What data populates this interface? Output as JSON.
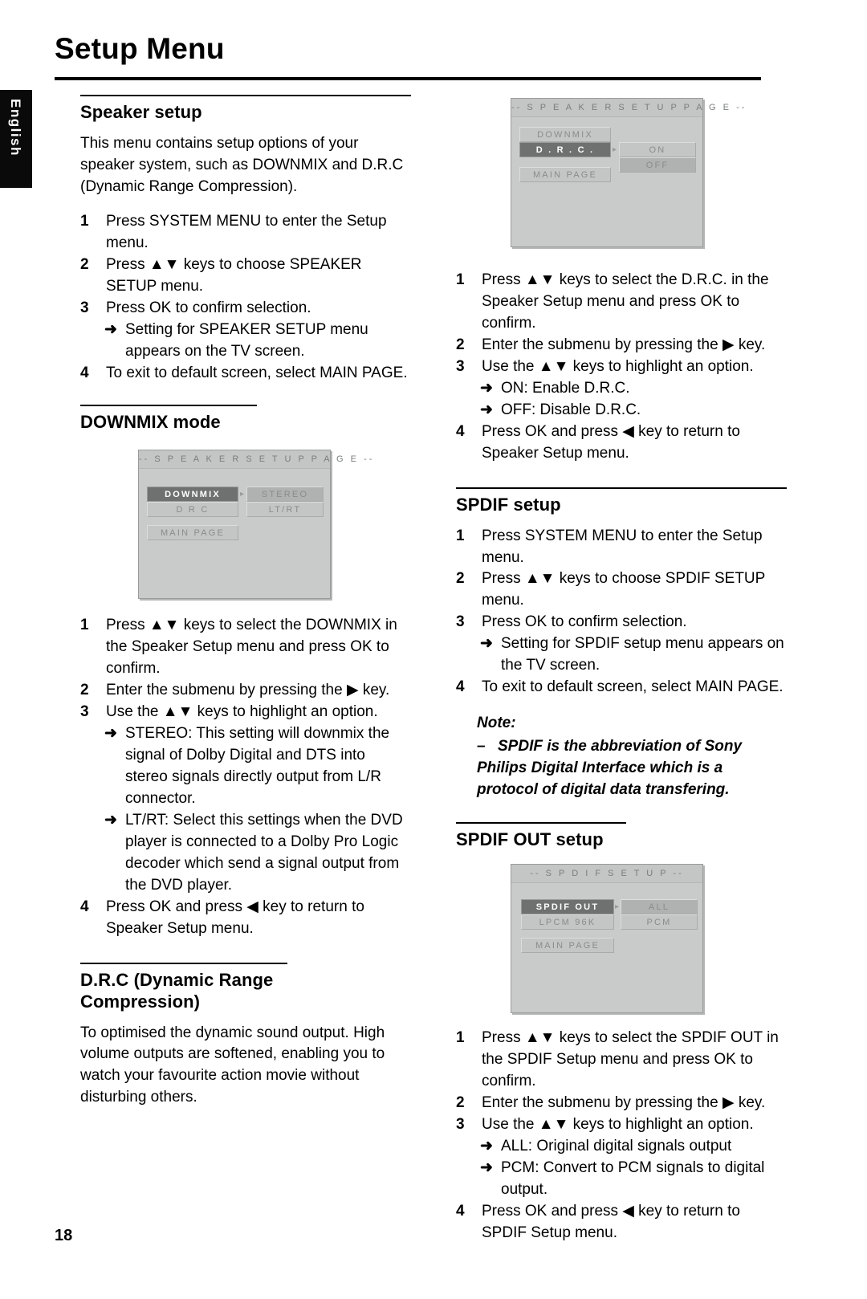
{
  "page": {
    "title": "Setup Menu",
    "number": "18",
    "language_tab": "English"
  },
  "left_column": {
    "speaker_setup": {
      "heading": "Speaker setup",
      "intro": "This menu contains setup options of your speaker system, such as DOWNMIX and D.R.C (Dynamic Range Compression).",
      "steps": [
        {
          "num": "1",
          "text": "Press SYSTEM MENU to enter the Setup menu."
        },
        {
          "num": "2",
          "text": "Press ▲▼ keys to choose SPEAKER SETUP menu."
        },
        {
          "num": "3",
          "text": "Press OK to confirm selection."
        },
        {
          "num": "4",
          "text": "To exit to default screen, select MAIN PAGE."
        }
      ],
      "arrow_after_step3": "Setting for SPEAKER SETUP menu appears on the TV screen."
    },
    "downmix": {
      "heading": "DOWNMIX mode",
      "osd": {
        "title": "--  S P E A K E R   S E T U P   P A G E  --",
        "items": [
          {
            "label": "DOWNMIX",
            "state": "selected"
          },
          {
            "label": "D  R  C",
            "state": "normal"
          },
          {
            "label": "MAIN PAGE",
            "state": "normal"
          }
        ],
        "sub_items": [
          {
            "label": "STEREO",
            "state": "sub-selected"
          },
          {
            "label": "LT/RT",
            "state": "normal"
          }
        ]
      },
      "steps": [
        {
          "num": "1",
          "text": "Press ▲▼ keys to select the DOWNMIX in the Speaker Setup menu and press OK to confirm."
        },
        {
          "num": "2",
          "text": "Enter the submenu by pressing the ▶ key."
        },
        {
          "num": "3",
          "text": "Use the ▲▼ keys to highlight an option."
        },
        {
          "num": "4",
          "text": "Press OK and press ◀ key to return to Speaker Setup menu."
        }
      ],
      "arrows_after_step3": [
        "STEREO: This setting will downmix the signal of Dolby Digital and DTS into stereo signals directly output from L/R connector.",
        "LT/RT: Select this settings when the DVD player is connected to a Dolby Pro Logic decoder which send a signal output from the DVD player."
      ]
    },
    "drc": {
      "heading_line1": "D.R.C (Dynamic Range",
      "heading_line2": "Compression)",
      "text": "To optimised the dynamic sound output. High volume outputs are softened, enabling you to watch your favourite action movie without disturbing others."
    }
  },
  "right_column": {
    "drc_osd": {
      "title": "--  S P E A K E R   S E T U P   P A G E  --",
      "items": [
        {
          "label": "DOWNMIX",
          "state": "normal"
        },
        {
          "label": "D . R . C .",
          "state": "selected"
        },
        {
          "label": "MAIN PAGE",
          "state": "normal"
        }
      ],
      "sub_items": [
        {
          "label": "ON",
          "state": "normal"
        },
        {
          "label": "OFF",
          "state": "sub-selected"
        }
      ]
    },
    "drc_steps": [
      {
        "num": "1",
        "text": "Press ▲▼ keys to select the D.R.C. in the Speaker Setup menu and press OK to confirm."
      },
      {
        "num": "2",
        "text": "Enter the submenu by pressing the ▶ key."
      },
      {
        "num": "3",
        "text": "Use the ▲▼ keys to highlight an option."
      },
      {
        "num": "4",
        "text": "Press OK and press ◀ key to return to Speaker Setup menu."
      }
    ],
    "drc_arrows": [
      "ON: Enable D.R.C.",
      "OFF: Disable D.R.C."
    ],
    "spdif_setup": {
      "heading": "SPDIF setup",
      "steps": [
        {
          "num": "1",
          "text": "Press SYSTEM MENU to enter the Setup menu."
        },
        {
          "num": "2",
          "text": "Press ▲▼ keys to choose SPDIF SETUP menu."
        },
        {
          "num": "3",
          "text": "Press OK to confirm selection."
        },
        {
          "num": "4",
          "text": "To exit to default screen, select MAIN PAGE."
        }
      ],
      "arrow_after_step3": "Setting for SPDIF setup menu appears on the TV screen.",
      "note_title": "Note:",
      "note_dash": "–",
      "note_text": "SPDIF is the abbreviation of Sony Philips Digital Interface which is a protocol of digital data transfering."
    },
    "spdif_out": {
      "heading": "SPDIF OUT setup",
      "osd": {
        "title": "--  S P D I F   S E T U P  --",
        "items": [
          {
            "label": "SPDIF OUT",
            "state": "selected"
          },
          {
            "label": "LPCM 96K",
            "state": "normal"
          },
          {
            "label": "MAIN PAGE",
            "state": "normal"
          }
        ],
        "sub_items": [
          {
            "label": "ALL",
            "state": "sub-selected"
          },
          {
            "label": "PCM",
            "state": "normal"
          }
        ]
      },
      "steps": [
        {
          "num": "1",
          "text": "Press ▲▼ keys to select the SPDIF OUT in the SPDIF Setup menu and press OK to confirm."
        },
        {
          "num": "2",
          "text": "Enter the submenu by pressing the ▶ key."
        },
        {
          "num": "3",
          "text": "Use the ▲▼ keys to highlight an option."
        },
        {
          "num": "4",
          "text": "Press OK and press ◀ key to return to SPDIF Setup menu."
        }
      ],
      "arrows_after_step3": [
        "ALL: Original digital signals output",
        "PCM: Convert to PCM signals to digital output."
      ]
    }
  },
  "colors": {
    "osd_bg": "#c9cbcb",
    "osd_selected": "#6f7171",
    "osd_subselected": "#b0b2b2",
    "text": "#000000"
  }
}
